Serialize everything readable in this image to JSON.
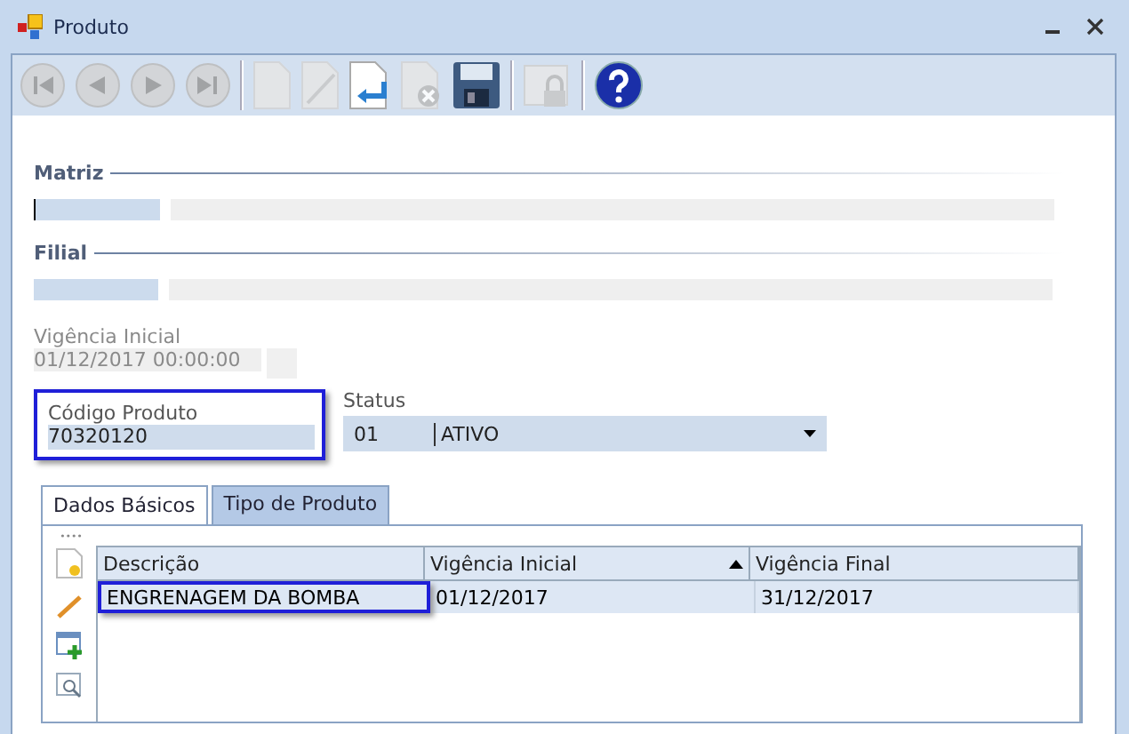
{
  "window": {
    "title": "Produto"
  },
  "toolbar": [
    {
      "kind": "first",
      "disabled": true
    },
    {
      "kind": "prev",
      "disabled": true
    },
    {
      "kind": "next",
      "disabled": true
    },
    {
      "kind": "last",
      "disabled": true
    },
    {
      "kind": "sep"
    },
    {
      "kind": "new",
      "disabled": true
    },
    {
      "kind": "edit",
      "disabled": true
    },
    {
      "kind": "undo",
      "disabled": false
    },
    {
      "kind": "delete",
      "disabled": true
    },
    {
      "kind": "save",
      "disabled": false
    },
    {
      "kind": "sep"
    },
    {
      "kind": "lock",
      "disabled": true
    },
    {
      "kind": "sep"
    },
    {
      "kind": "help",
      "disabled": false
    }
  ],
  "matriz": {
    "label": "Matriz"
  },
  "filial": {
    "label": "Filial"
  },
  "vigencia_inicial": {
    "label": "Vigência Inicial",
    "value": "01/12/2017 00:00:00",
    "disabled": true
  },
  "codigo_produto": {
    "label": "Código Produto",
    "value": "70320120",
    "highlighted": true
  },
  "status": {
    "label": "Status",
    "code": "01",
    "value": "ATIVO"
  },
  "tabs": [
    {
      "label": "Dados Básicos",
      "selected": true
    },
    {
      "label": "Tipo de Produto",
      "selected": false
    }
  ],
  "side_tools": [
    {
      "kind": "new"
    },
    {
      "kind": "edit"
    },
    {
      "kind": "add"
    },
    {
      "kind": "view"
    }
  ],
  "table": {
    "columns": [
      {
        "label": "Descrição",
        "sorted": false
      },
      {
        "label": "Vigência Inicial",
        "sorted": true
      },
      {
        "label": "Vigência Final",
        "sorted": false
      }
    ],
    "rows": [
      {
        "cells": [
          {
            "text": "ENGRENAGEM DA BOMBA",
            "highlighted": true
          },
          {
            "text": "01/12/2017",
            "highlighted": false
          },
          {
            "text": "31/12/2017",
            "highlighted": false
          }
        ],
        "selected": true
      }
    ]
  }
}
